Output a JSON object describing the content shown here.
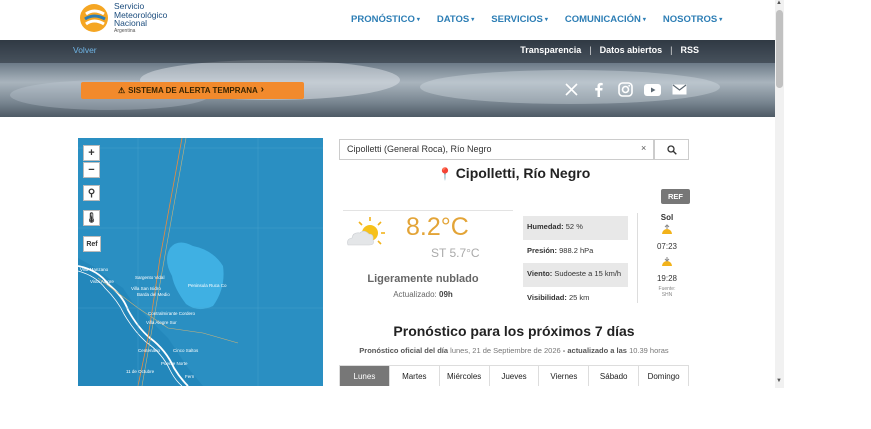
{
  "logo": {
    "line1": "Servicio",
    "line2": "Meteorológico",
    "line3": "Nacional",
    "line4": "Argentina"
  },
  "nav": [
    {
      "label": "PRONÓSTICO"
    },
    {
      "label": "DATOS"
    },
    {
      "label": "SERVICIOS"
    },
    {
      "label": "COMUNICACIÓN"
    },
    {
      "label": "NOSOTROS"
    }
  ],
  "banner": {
    "back_label": "Volver",
    "links": [
      "Transparencia",
      "Datos abiertos",
      "RSS"
    ],
    "separator": "|",
    "alert_label": "SISTEMA DE ALERTA TEMPRANA"
  },
  "social_icons": [
    "x-icon",
    "facebook-icon",
    "instagram-icon",
    "youtube-icon",
    "mail-icon"
  ],
  "map": {
    "zoom_in": "+",
    "zoom_out": "−",
    "ref_label": "Ref",
    "labels": [
      "Villa Manzano",
      "Sargento Vidal",
      "Vista Alegre",
      "Villa San Isidro",
      "Barda del Medio",
      "Peninsula Ruca Co",
      "Contralmirante Cordero",
      "Villa Alegre Sur",
      "Cinco Saltos",
      "Centenario",
      "Puente Norte",
      "11 de Octubre",
      "Fern"
    ]
  },
  "search": {
    "value": "Cipolletti (General Roca), Río Negro",
    "clear": "×"
  },
  "location": "Cipolletti, Río Negro",
  "ref_button": "REF",
  "current": {
    "temperature": "8.2°C",
    "feels_like": "ST 5.7°C",
    "description": "Ligeramente nublado",
    "updated_label": "Actualizado:",
    "updated_time": "09h",
    "icon": "partly-cloudy-icon"
  },
  "details": [
    {
      "label": "Humedad:",
      "value": "52 %"
    },
    {
      "label": "Presión:",
      "value": "988.2 hPa"
    },
    {
      "label": "Viento:",
      "value": "Sudoeste a 15 km/h"
    },
    {
      "label": "Visibilidad:",
      "value": "25 km"
    }
  ],
  "sun": {
    "title": "Sol",
    "sunrise": "07:23",
    "sunset": "19:28",
    "note1": "Fuente:",
    "note2": "SHN"
  },
  "forecast": {
    "title": "Pronóstico para los próximos 7 días",
    "sub_prefix": "Pronóstico oficial del día",
    "sub_date": "lunes, 21 de Septiembre de 2026",
    "sub_suffix": "- actualizado a las",
    "sub_time": "10.39 horas",
    "days": [
      "Lunes",
      "Martes",
      "Miércoles",
      "Jueves",
      "Viernes",
      "Sábado",
      "Domingo"
    ],
    "active_day": "Lunes"
  },
  "colors": {
    "nav": "#2d7eb5",
    "alert": "#f28a2c",
    "temperature": "#e3a437",
    "map_water": "#2a8fc2"
  }
}
